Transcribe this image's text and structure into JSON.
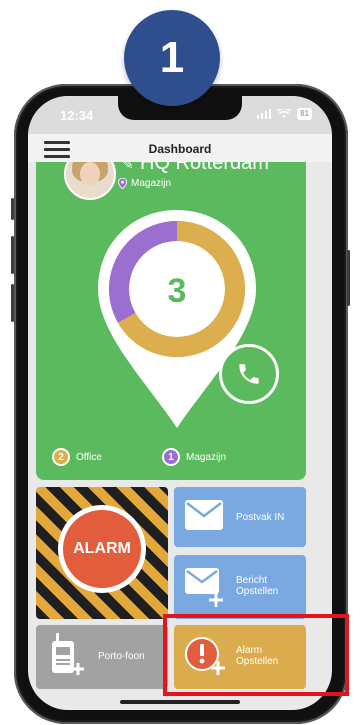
{
  "step_badge": "1",
  "status_bar": {
    "time": "12:34",
    "battery": "81"
  },
  "header": {
    "title": "Dashboard"
  },
  "location": {
    "name": "HQ Rotterdam",
    "sub_location": "Magazijn"
  },
  "donut": {
    "center_value": "3",
    "segments": [
      {
        "label": "Office",
        "value": 2,
        "color": "#dcae4d"
      },
      {
        "label": "Magazijn",
        "value": 1,
        "color": "#9b6fd0"
      }
    ]
  },
  "legend": [
    {
      "count": "2",
      "label": "Office",
      "color": "#dcae4d"
    },
    {
      "count": "1",
      "label": "Magazijn",
      "color": "#9b6fd0"
    }
  ],
  "tiles": {
    "alarm": "ALARM",
    "postvak": "Postvak IN",
    "bericht_line1": "Bericht",
    "bericht_line2": "Opstellen",
    "porto": "Porto-foon",
    "alarm_op_line1": "Alarm",
    "alarm_op_line2": "Opstellen"
  },
  "colors": {
    "green": "#5cba5e",
    "blue": "#7aa9e2",
    "alarm_red": "#e25d3c",
    "gold": "#dbac4d",
    "gray": "#a2a2a2",
    "highlight": "#e3141b"
  }
}
